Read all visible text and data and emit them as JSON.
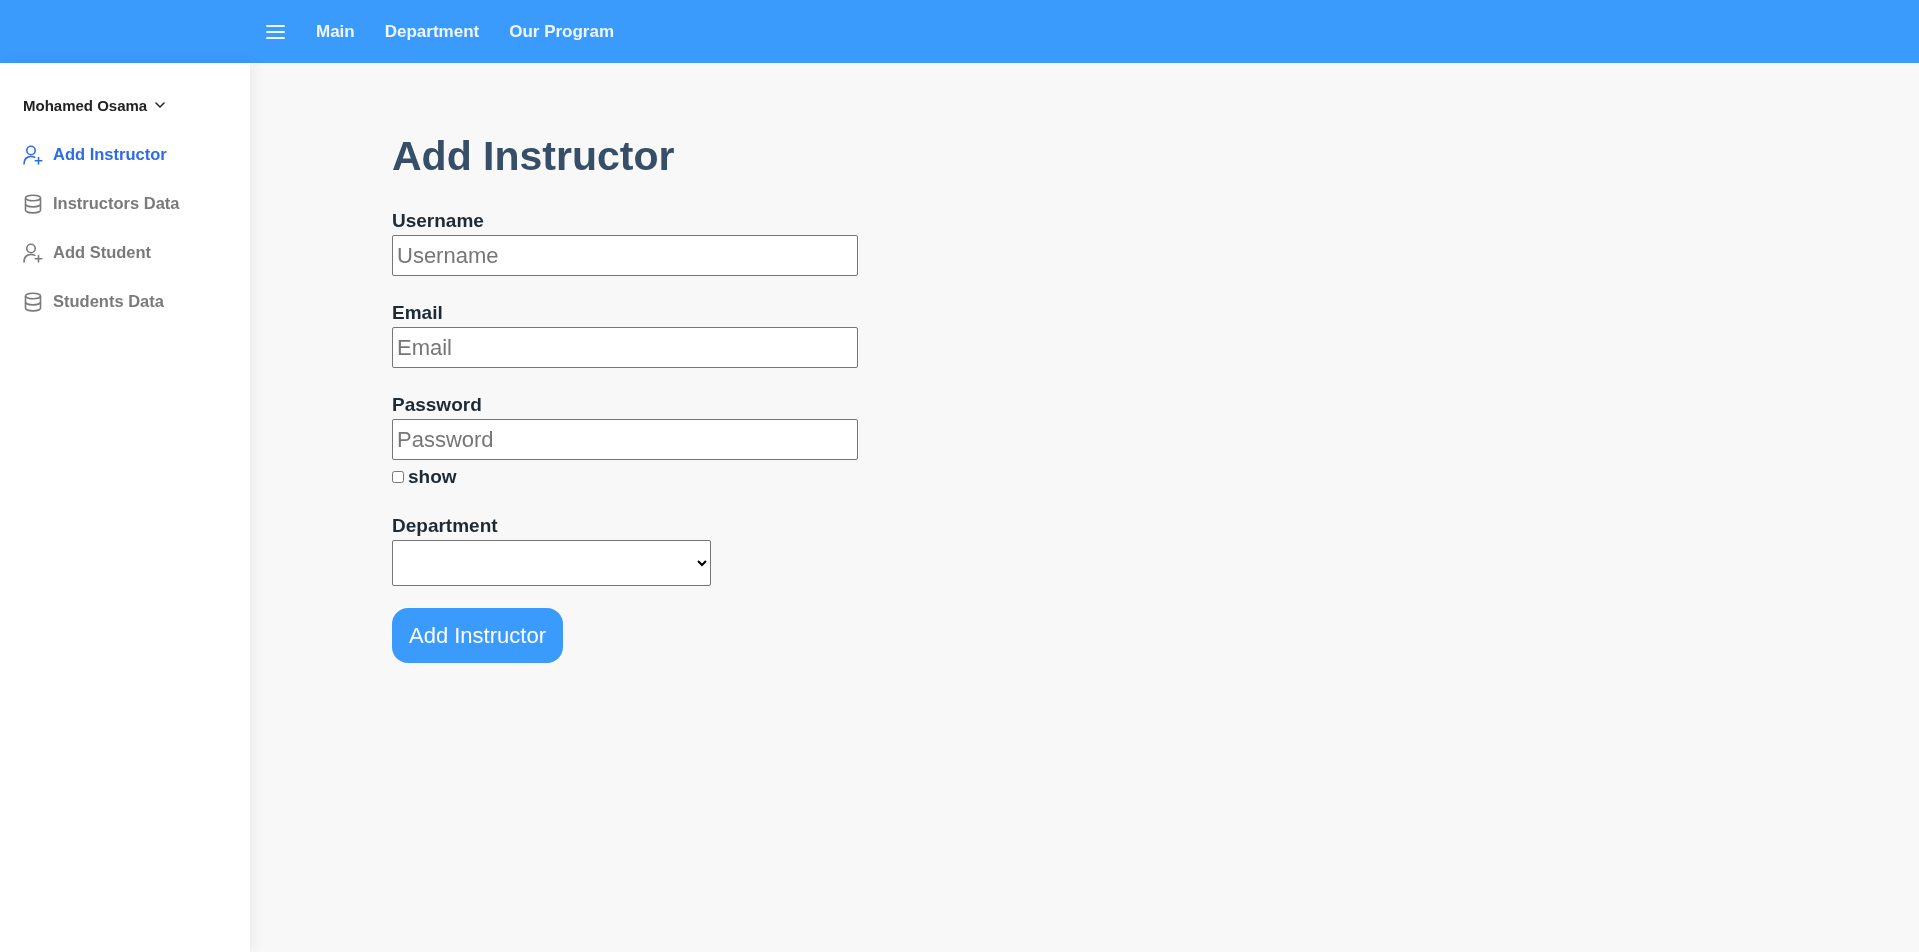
{
  "topbar": {
    "nav_links": [
      "Main",
      "Department",
      "Our Program"
    ]
  },
  "sidebar": {
    "user_name": "Mohamed Osama",
    "items": [
      {
        "label": "Add Instructor",
        "kind": "add",
        "selected": true
      },
      {
        "label": "Instructors Data",
        "kind": "data",
        "selected": false
      },
      {
        "label": "Add Student",
        "kind": "add",
        "selected": false
      },
      {
        "label": "Students Data",
        "kind": "data",
        "selected": false
      }
    ]
  },
  "form": {
    "title": "Add Instructor",
    "fields": [
      {
        "kind": "text",
        "label": "Username",
        "placeholder": "Username"
      },
      {
        "kind": "text",
        "label": "Email",
        "placeholder": "Email"
      },
      {
        "kind": "password",
        "label": "Password",
        "placeholder": "Password",
        "show_toggle": {
          "label": "show",
          "checked": false
        }
      },
      {
        "kind": "select",
        "label": "Department"
      }
    ],
    "submit": "Add Instructor"
  }
}
